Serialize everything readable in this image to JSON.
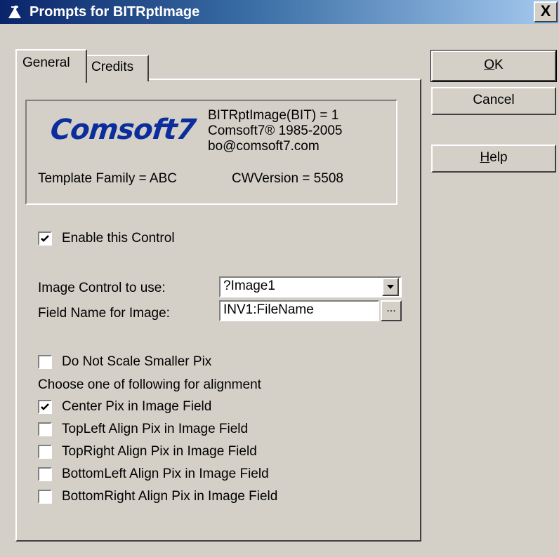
{
  "window": {
    "title": "Prompts for BITRptImage",
    "close_label": "X"
  },
  "tabs": [
    {
      "label": "General"
    },
    {
      "label": "Credits"
    }
  ],
  "about": {
    "logo_text": "Comsoft7",
    "version_line": "BITRptImage(BIT) = 1",
    "copyright_line": "Comsoft7® 1985-2005",
    "email": "bo@comsoft7.com",
    "template_family": "Template Family = ABC",
    "cw_version": "CWVersion = 5508"
  },
  "enable_control": {
    "label": "Enable this Control",
    "checked": true
  },
  "image_control": {
    "label": "Image Control to use:",
    "value": "?Image1"
  },
  "field_name": {
    "label": "Field Name for Image:",
    "value": "INV1:FileName",
    "browse_label": "..."
  },
  "do_not_scale": {
    "label": "Do Not Scale Smaller Pix",
    "checked": false
  },
  "alignment_heading": "Choose one of following for alignment",
  "alignment_options": [
    {
      "label": "Center Pix in Image Field",
      "checked": true
    },
    {
      "label": "TopLeft Align Pix in Image Field",
      "checked": false
    },
    {
      "label": "TopRight Align Pix in Image Field",
      "checked": false
    },
    {
      "label": "BottomLeft Align Pix in Image Field",
      "checked": false
    },
    {
      "label": "BottomRight Align Pix in Image Field",
      "checked": false
    }
  ],
  "buttons": {
    "ok": {
      "mnemonic": "O",
      "rest": "K"
    },
    "cancel": {
      "label": "Cancel"
    },
    "help": {
      "mnemonic": "H",
      "rest": "elp"
    }
  },
  "colors": {
    "titlebar_start": "#0a246a",
    "titlebar_end": "#a6caf0",
    "face": "#d4d0c8",
    "logo": "#0b2e9c"
  }
}
